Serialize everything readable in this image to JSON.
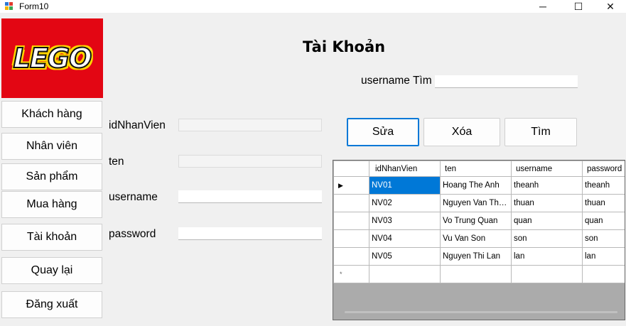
{
  "window": {
    "title": "Form10",
    "minimize_glyph": "─",
    "maximize_glyph": "☐",
    "close_glyph": "✕"
  },
  "logo": {
    "text": "LEGO",
    "colors": {
      "background": "#e30613",
      "text": "#ffffff",
      "outline": "#ffd500"
    }
  },
  "sidebar": {
    "items": [
      {
        "label": "Khách hàng"
      },
      {
        "label": "Nhân viên"
      },
      {
        "label": "Sản phẩm"
      },
      {
        "label": "Mua hàng"
      },
      {
        "label": "Tài khoản"
      },
      {
        "label": "Quay lại"
      },
      {
        "label": "Đăng xuất"
      }
    ]
  },
  "form": {
    "heading": "Tài Khoản",
    "search_label": "username Tìm",
    "search_value": "",
    "fields": [
      {
        "label": "idNhanVien",
        "value": "",
        "disabled": true
      },
      {
        "label": "ten",
        "value": "",
        "disabled": true
      },
      {
        "label": "username",
        "value": "",
        "disabled": false
      },
      {
        "label": "password",
        "value": "",
        "disabled": false
      }
    ]
  },
  "actions": {
    "edit_label": "Sửa",
    "delete_label": "Xóa",
    "search_label": "Tìm"
  },
  "grid": {
    "columns": [
      "idNhanVien",
      "ten",
      "username",
      "password"
    ],
    "rows": [
      [
        "NV01",
        "Hoang The Anh",
        "theanh",
        "theanh"
      ],
      [
        "NV02",
        "Nguyen Van Thuan",
        "thuan",
        "thuan"
      ],
      [
        "NV03",
        "Vo Trung Quan",
        "quan",
        "quan"
      ],
      [
        "NV04",
        "Vu Van Son",
        "son",
        "son"
      ],
      [
        "NV05",
        "Nguyen Thi Lan",
        "lan",
        "lan"
      ]
    ],
    "current_row_marker": "▶",
    "new_row_marker": "*",
    "colors": {
      "selection": "#0078d7"
    }
  }
}
